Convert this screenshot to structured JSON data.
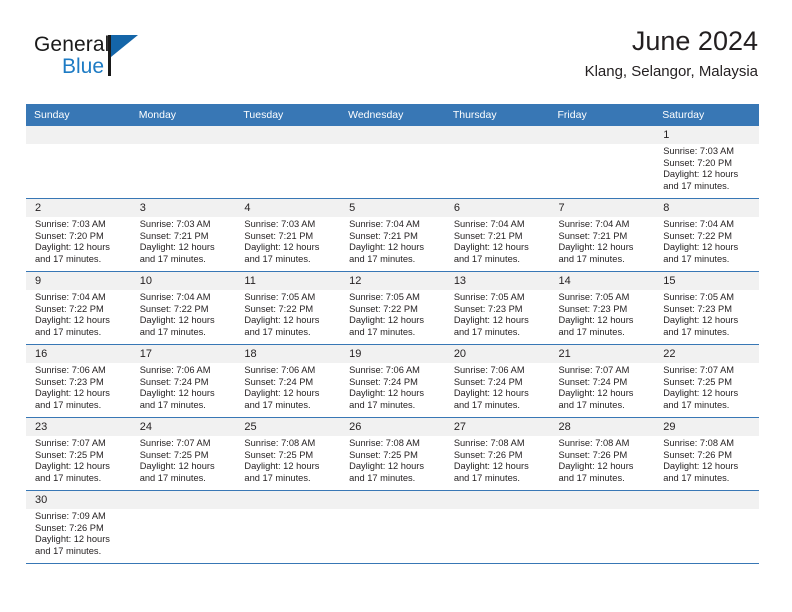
{
  "brand": {
    "line1": "General",
    "line2": "Blue",
    "flag_icon": "blue-triangle-flag-icon",
    "accent_color": "#1d7bc4"
  },
  "header": {
    "title": "June 2024",
    "subtitle": "Klang, Selangor, Malaysia"
  },
  "theme": {
    "header_row_bg": "#3877b5",
    "daynum_band_bg": "#f1f1f1",
    "rule_color": "#3877b5",
    "text_color": "#231f20"
  },
  "calendar": {
    "weekday_headers": [
      "Sunday",
      "Monday",
      "Tuesday",
      "Wednesday",
      "Thursday",
      "Friday",
      "Saturday"
    ],
    "weeks": [
      [
        {
          "day": "",
          "sunrise": "",
          "sunset": "",
          "daylight_line1": "",
          "daylight_line2": ""
        },
        {
          "day": "",
          "sunrise": "",
          "sunset": "",
          "daylight_line1": "",
          "daylight_line2": ""
        },
        {
          "day": "",
          "sunrise": "",
          "sunset": "",
          "daylight_line1": "",
          "daylight_line2": ""
        },
        {
          "day": "",
          "sunrise": "",
          "sunset": "",
          "daylight_line1": "",
          "daylight_line2": ""
        },
        {
          "day": "",
          "sunrise": "",
          "sunset": "",
          "daylight_line1": "",
          "daylight_line2": ""
        },
        {
          "day": "",
          "sunrise": "",
          "sunset": "",
          "daylight_line1": "",
          "daylight_line2": ""
        },
        {
          "day": "1",
          "sunrise": "Sunrise: 7:03 AM",
          "sunset": "Sunset: 7:20 PM",
          "daylight_line1": "Daylight: 12 hours",
          "daylight_line2": "and 17 minutes."
        }
      ],
      [
        {
          "day": "2",
          "sunrise": "Sunrise: 7:03 AM",
          "sunset": "Sunset: 7:20 PM",
          "daylight_line1": "Daylight: 12 hours",
          "daylight_line2": "and 17 minutes."
        },
        {
          "day": "3",
          "sunrise": "Sunrise: 7:03 AM",
          "sunset": "Sunset: 7:21 PM",
          "daylight_line1": "Daylight: 12 hours",
          "daylight_line2": "and 17 minutes."
        },
        {
          "day": "4",
          "sunrise": "Sunrise: 7:03 AM",
          "sunset": "Sunset: 7:21 PM",
          "daylight_line1": "Daylight: 12 hours",
          "daylight_line2": "and 17 minutes."
        },
        {
          "day": "5",
          "sunrise": "Sunrise: 7:04 AM",
          "sunset": "Sunset: 7:21 PM",
          "daylight_line1": "Daylight: 12 hours",
          "daylight_line2": "and 17 minutes."
        },
        {
          "day": "6",
          "sunrise": "Sunrise: 7:04 AM",
          "sunset": "Sunset: 7:21 PM",
          "daylight_line1": "Daylight: 12 hours",
          "daylight_line2": "and 17 minutes."
        },
        {
          "day": "7",
          "sunrise": "Sunrise: 7:04 AM",
          "sunset": "Sunset: 7:21 PM",
          "daylight_line1": "Daylight: 12 hours",
          "daylight_line2": "and 17 minutes."
        },
        {
          "day": "8",
          "sunrise": "Sunrise: 7:04 AM",
          "sunset": "Sunset: 7:22 PM",
          "daylight_line1": "Daylight: 12 hours",
          "daylight_line2": "and 17 minutes."
        }
      ],
      [
        {
          "day": "9",
          "sunrise": "Sunrise: 7:04 AM",
          "sunset": "Sunset: 7:22 PM",
          "daylight_line1": "Daylight: 12 hours",
          "daylight_line2": "and 17 minutes."
        },
        {
          "day": "10",
          "sunrise": "Sunrise: 7:04 AM",
          "sunset": "Sunset: 7:22 PM",
          "daylight_line1": "Daylight: 12 hours",
          "daylight_line2": "and 17 minutes."
        },
        {
          "day": "11",
          "sunrise": "Sunrise: 7:05 AM",
          "sunset": "Sunset: 7:22 PM",
          "daylight_line1": "Daylight: 12 hours",
          "daylight_line2": "and 17 minutes."
        },
        {
          "day": "12",
          "sunrise": "Sunrise: 7:05 AM",
          "sunset": "Sunset: 7:22 PM",
          "daylight_line1": "Daylight: 12 hours",
          "daylight_line2": "and 17 minutes."
        },
        {
          "day": "13",
          "sunrise": "Sunrise: 7:05 AM",
          "sunset": "Sunset: 7:23 PM",
          "daylight_line1": "Daylight: 12 hours",
          "daylight_line2": "and 17 minutes."
        },
        {
          "day": "14",
          "sunrise": "Sunrise: 7:05 AM",
          "sunset": "Sunset: 7:23 PM",
          "daylight_line1": "Daylight: 12 hours",
          "daylight_line2": "and 17 minutes."
        },
        {
          "day": "15",
          "sunrise": "Sunrise: 7:05 AM",
          "sunset": "Sunset: 7:23 PM",
          "daylight_line1": "Daylight: 12 hours",
          "daylight_line2": "and 17 minutes."
        }
      ],
      [
        {
          "day": "16",
          "sunrise": "Sunrise: 7:06 AM",
          "sunset": "Sunset: 7:23 PM",
          "daylight_line1": "Daylight: 12 hours",
          "daylight_line2": "and 17 minutes."
        },
        {
          "day": "17",
          "sunrise": "Sunrise: 7:06 AM",
          "sunset": "Sunset: 7:24 PM",
          "daylight_line1": "Daylight: 12 hours",
          "daylight_line2": "and 17 minutes."
        },
        {
          "day": "18",
          "sunrise": "Sunrise: 7:06 AM",
          "sunset": "Sunset: 7:24 PM",
          "daylight_line1": "Daylight: 12 hours",
          "daylight_line2": "and 17 minutes."
        },
        {
          "day": "19",
          "sunrise": "Sunrise: 7:06 AM",
          "sunset": "Sunset: 7:24 PM",
          "daylight_line1": "Daylight: 12 hours",
          "daylight_line2": "and 17 minutes."
        },
        {
          "day": "20",
          "sunrise": "Sunrise: 7:06 AM",
          "sunset": "Sunset: 7:24 PM",
          "daylight_line1": "Daylight: 12 hours",
          "daylight_line2": "and 17 minutes."
        },
        {
          "day": "21",
          "sunrise": "Sunrise: 7:07 AM",
          "sunset": "Sunset: 7:24 PM",
          "daylight_line1": "Daylight: 12 hours",
          "daylight_line2": "and 17 minutes."
        },
        {
          "day": "22",
          "sunrise": "Sunrise: 7:07 AM",
          "sunset": "Sunset: 7:25 PM",
          "daylight_line1": "Daylight: 12 hours",
          "daylight_line2": "and 17 minutes."
        }
      ],
      [
        {
          "day": "23",
          "sunrise": "Sunrise: 7:07 AM",
          "sunset": "Sunset: 7:25 PM",
          "daylight_line1": "Daylight: 12 hours",
          "daylight_line2": "and 17 minutes."
        },
        {
          "day": "24",
          "sunrise": "Sunrise: 7:07 AM",
          "sunset": "Sunset: 7:25 PM",
          "daylight_line1": "Daylight: 12 hours",
          "daylight_line2": "and 17 minutes."
        },
        {
          "day": "25",
          "sunrise": "Sunrise: 7:08 AM",
          "sunset": "Sunset: 7:25 PM",
          "daylight_line1": "Daylight: 12 hours",
          "daylight_line2": "and 17 minutes."
        },
        {
          "day": "26",
          "sunrise": "Sunrise: 7:08 AM",
          "sunset": "Sunset: 7:25 PM",
          "daylight_line1": "Daylight: 12 hours",
          "daylight_line2": "and 17 minutes."
        },
        {
          "day": "27",
          "sunrise": "Sunrise: 7:08 AM",
          "sunset": "Sunset: 7:26 PM",
          "daylight_line1": "Daylight: 12 hours",
          "daylight_line2": "and 17 minutes."
        },
        {
          "day": "28",
          "sunrise": "Sunrise: 7:08 AM",
          "sunset": "Sunset: 7:26 PM",
          "daylight_line1": "Daylight: 12 hours",
          "daylight_line2": "and 17 minutes."
        },
        {
          "day": "29",
          "sunrise": "Sunrise: 7:08 AM",
          "sunset": "Sunset: 7:26 PM",
          "daylight_line1": "Daylight: 12 hours",
          "daylight_line2": "and 17 minutes."
        }
      ],
      [
        {
          "day": "30",
          "sunrise": "Sunrise: 7:09 AM",
          "sunset": "Sunset: 7:26 PM",
          "daylight_line1": "Daylight: 12 hours",
          "daylight_line2": "and 17 minutes."
        },
        {
          "day": "",
          "sunrise": "",
          "sunset": "",
          "daylight_line1": "",
          "daylight_line2": ""
        },
        {
          "day": "",
          "sunrise": "",
          "sunset": "",
          "daylight_line1": "",
          "daylight_line2": ""
        },
        {
          "day": "",
          "sunrise": "",
          "sunset": "",
          "daylight_line1": "",
          "daylight_line2": ""
        },
        {
          "day": "",
          "sunrise": "",
          "sunset": "",
          "daylight_line1": "",
          "daylight_line2": ""
        },
        {
          "day": "",
          "sunrise": "",
          "sunset": "",
          "daylight_line1": "",
          "daylight_line2": ""
        },
        {
          "day": "",
          "sunrise": "",
          "sunset": "",
          "daylight_line1": "",
          "daylight_line2": ""
        }
      ]
    ]
  }
}
